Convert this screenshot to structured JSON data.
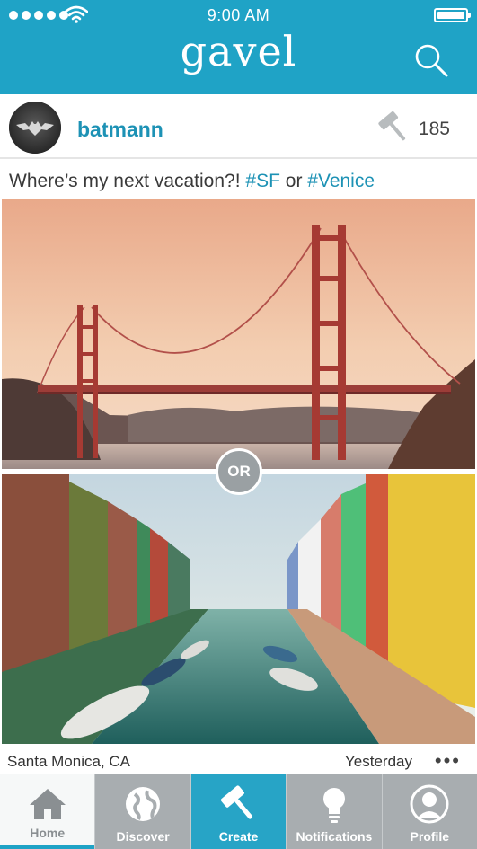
{
  "status_bar": {
    "time": "9:00 AM"
  },
  "header": {
    "logo": "gavel",
    "search_icon": "search-icon"
  },
  "post": {
    "username": "batmann",
    "gavel_count": "185",
    "caption": {
      "text": "Where’s my next vacation?!",
      "tag1": "#SF",
      "joiner": "or",
      "tag2": "#Venice"
    },
    "or_label": "OR",
    "location": "Santa Monica, CA",
    "timestamp": "Yesterday",
    "more": "•••"
  },
  "tabs": [
    {
      "label": "Home",
      "icon": "home-icon",
      "selected": true
    },
    {
      "label": "Discover",
      "icon": "globe-icon"
    },
    {
      "label": "Create",
      "icon": "gavel-icon"
    },
    {
      "label": "Notifications",
      "icon": "lightbulb-icon"
    },
    {
      "label": "Profile",
      "icon": "profile-icon"
    }
  ],
  "colors": {
    "brand": "#1fa3c6",
    "link": "#1d92b5",
    "tab_inactive": "#a8adb0"
  }
}
